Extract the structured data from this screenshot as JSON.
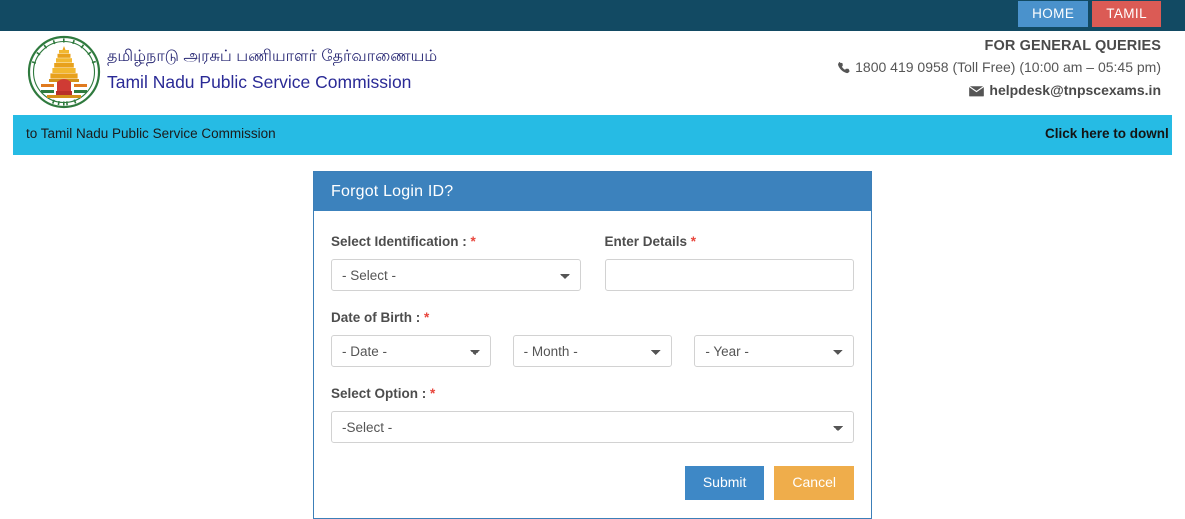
{
  "topbar": {
    "buttons": [
      {
        "label": "HOME",
        "name": "home-button",
        "color": "#4a92cc"
      },
      {
        "label": "TAMIL",
        "name": "tamil-button",
        "color": "#db5b55"
      }
    ],
    "background": "#124a63"
  },
  "header": {
    "logo_alt": "tnpsc-emblem",
    "org_tamil": "தமிழ்நாடு அரசுப் பணியாளர் தேர்வாணையம்",
    "org_english": "Tamil Nadu Public Service Commission",
    "queries": {
      "title": "FOR GENERAL QUERIES",
      "phone_icon": "phone-icon",
      "phone": "1800 419 0958 (Toll Free)  (10:00 am – 05:45 pm)",
      "email_icon": "envelope-icon",
      "email": "helpdesk@tnpscexams.in"
    }
  },
  "marquee": {
    "background": "#26bbe4",
    "left_text": "to Tamil Nadu Public Service Commission",
    "right_text": "Click here to downl"
  },
  "panel": {
    "title": "Forgot Login ID?",
    "header_color": "#3c82bd",
    "fields": {
      "identification": {
        "label": "Select Identification : ",
        "required": "*",
        "value": "- Select -"
      },
      "details": {
        "label": "Enter Details ",
        "required": "*",
        "value": "",
        "placeholder": ""
      },
      "dob": {
        "label": "Date of Birth : ",
        "required": "*",
        "date_value": "- Date -",
        "month_value": "- Month -",
        "year_value": "- Year -"
      },
      "option": {
        "label": "Select Option : ",
        "required": "*",
        "value": "-Select -"
      }
    },
    "buttons": {
      "submit": "Submit",
      "cancel": "Cancel",
      "submit_color": "#3e88c6",
      "cancel_color": "#efad4b"
    }
  }
}
